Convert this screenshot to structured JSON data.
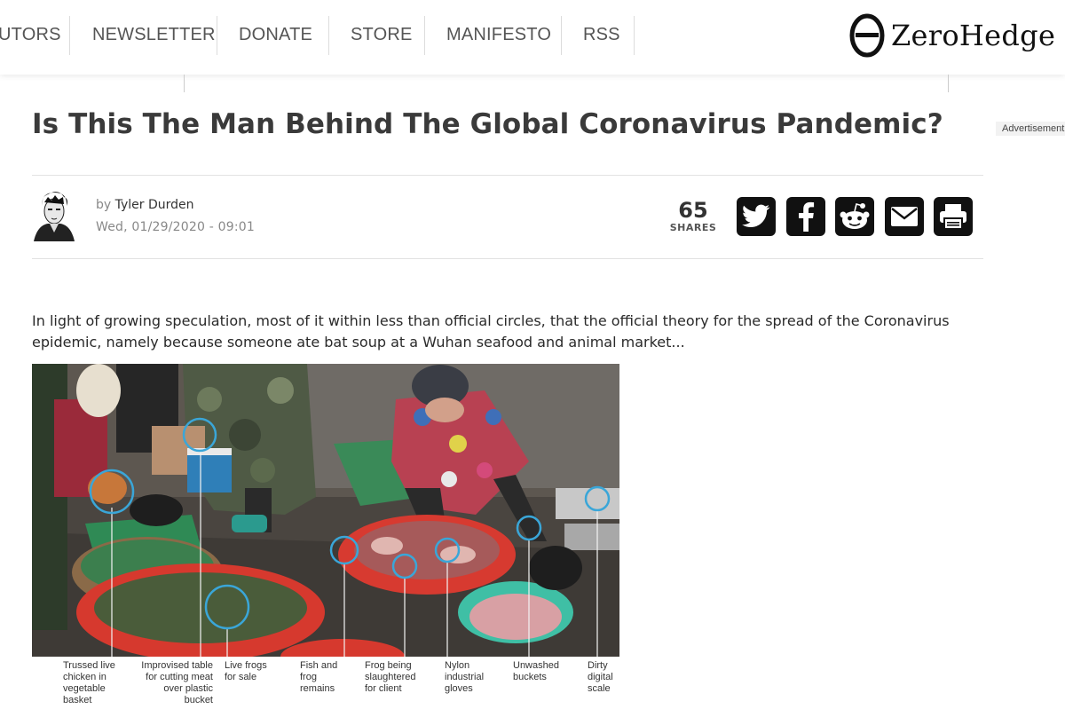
{
  "nav": {
    "items": [
      "UTORS",
      "NEWSLETTER",
      "DONATE",
      "STORE",
      "MANIFESTO",
      "RSS"
    ]
  },
  "logo": {
    "text": "ZeroHedge"
  },
  "advertisement": {
    "label": "Advertisement"
  },
  "article": {
    "title": "Is This The Man Behind The Global Coronavirus Pandemic?",
    "byline_prefix": "by",
    "author": "Tyler Durden",
    "date": "Wed, 01/29/2020 - 09:01",
    "lead": "In light of growing speculation, most of it within less than official circles, that the official theory for the spread of the Coronavirus epidemic, namely because someone ate bat soup at a Wuhan seafood and animal market..."
  },
  "shares": {
    "count": "65",
    "label": "SHARES"
  },
  "share_buttons": [
    "twitter-icon",
    "facebook-icon",
    "reddit-icon",
    "email-icon",
    "print-icon"
  ],
  "figure": {
    "captions": [
      "Trussed live chicken in vegetable basket",
      "Improvised table for cutting meat over plastic bucket",
      "Live frogs for sale",
      "Fish and frog remains",
      "Frog being slaughtered for client",
      "Nylon industrial gloves",
      "Unwashed buckets",
      "Dirty digital scale"
    ]
  },
  "colors": {
    "text_dark": "#3a3a3a",
    "button_black": "#111111",
    "circle_marker": "#3aa6d8"
  }
}
